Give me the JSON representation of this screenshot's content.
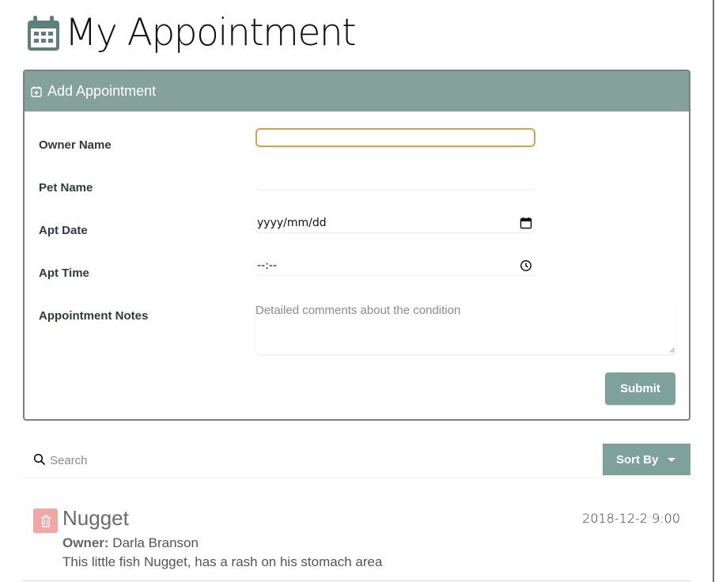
{
  "app": {
    "title": "My Appointment",
    "title_icon": "calendar-icon",
    "accent_color": "#84a19c",
    "danger_color": "#f1a7a5"
  },
  "add_form": {
    "header_label": "Add Appointment",
    "header_icon": "calendar-plus-icon",
    "fields": {
      "owner_name": {
        "label": "Owner Name",
        "value": ""
      },
      "pet_name": {
        "label": "Pet Name",
        "value": ""
      },
      "apt_date": {
        "label": "Apt Date",
        "value": "yyyy/mm/dd",
        "icon": "calendar-icon"
      },
      "apt_time": {
        "label": "Apt Time",
        "value": "--:--",
        "icon": "clock-icon"
      },
      "notes": {
        "label": "Appointment Notes",
        "placeholder": "Detailed comments about the condition"
      }
    },
    "submit_label": "Submit"
  },
  "search": {
    "placeholder": "Search",
    "icon": "search-icon",
    "sort_label": "Sort By"
  },
  "appointments": [
    {
      "pet_name": "Nugget",
      "datetime": "2018-12-2 9:00",
      "owner_label": "Owner:",
      "owner_name": "Darla Branson",
      "notes": "This little fish Nugget, has a rash on his stomach area"
    }
  ]
}
